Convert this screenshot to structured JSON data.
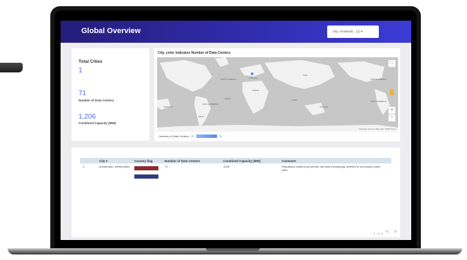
{
  "header": {
    "title": "Global Overview",
    "city_filter": "City: Amsterda... (1) ▾"
  },
  "kpis": {
    "title": "Total Cities",
    "total_cities": "1",
    "data_centers_value": "71",
    "data_centers_label": "Number of Data Centers",
    "capacity_value": "1,206",
    "capacity_label": "Combined Capacity (MW)"
  },
  "map": {
    "title": "City, color indicates Number of Data Centers",
    "regions": [
      "NORTH AMERICA",
      "EUROPE",
      "ASIA",
      "AFRICA",
      "SOUTH AMERICA",
      "OCEANIA",
      "NORTH AMERICA",
      "SOUTH AMERICA",
      "OCEANIA",
      "Pacific",
      "Atlantic",
      "Indian"
    ],
    "google": "Google",
    "attribution": "Keyboard shortcuts   Map data ©2025   Terms",
    "legend_label": "Number of Data Centers",
    "legend_min": "71",
    "legend_max": "71",
    "controls": {
      "fullscreen": "⛶",
      "zoom_in": "+",
      "zoom_out": "−"
    }
  },
  "table": {
    "headers": [
      "City ▾",
      "Country flag",
      "Number of Data Centers",
      "Combined Capacity (MW)",
      "Comment"
    ],
    "rows": [
      {
        "index": "1.",
        "city": "Amsterdam, Netherlands",
        "data_centers": "71",
        "capacity": "1206",
        "comment": "Regulatory bottlenecks persist; demand increasingly diverted to secondary Dutch sites."
      }
    ],
    "pager": "1 - 1 / 1",
    "prev": "<",
    "next": ">"
  },
  "colors": {
    "header_start": "#251d7a",
    "header_end": "#3b3bd6",
    "accent": "#5868e6",
    "flag_red": "#8e2a31",
    "flag_blue": "#2e3c80"
  }
}
